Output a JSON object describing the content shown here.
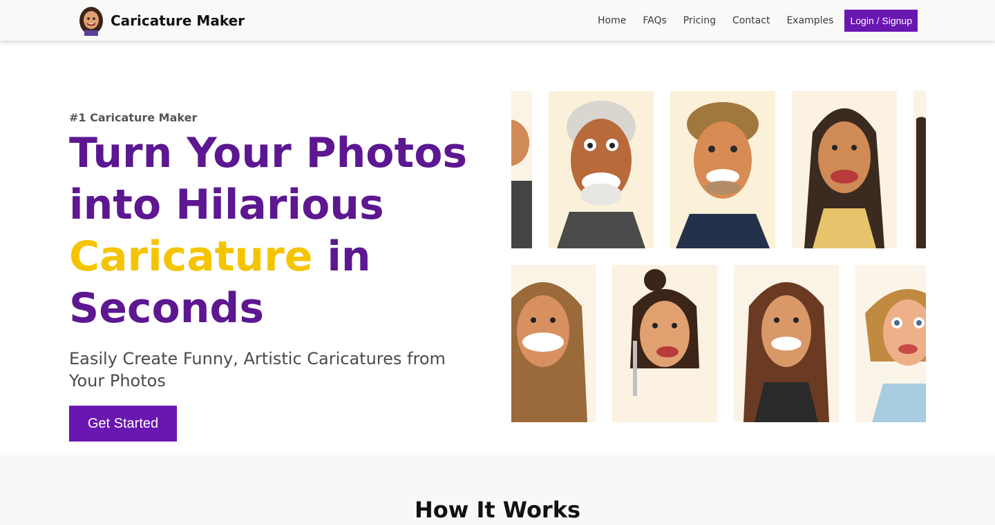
{
  "nav": {
    "brand": "Caricature Maker",
    "links": [
      "Home",
      "FAQs",
      "Pricing",
      "Contact",
      "Examples"
    ],
    "login": "Login / Signup"
  },
  "hero": {
    "kicker": "#1 Caricature Maker",
    "headline_part1": "Turn Your Photos into Hilarious",
    "headline_highlight": "Caricature",
    "headline_part2": "in Seconds",
    "subhead": "Easily Create Funny, Artistic Caricatures from Your Photos",
    "cta": "Get Started"
  },
  "colors": {
    "accent": "#6a16b0",
    "headline": "#5c1791",
    "highlight": "#f5c400"
  },
  "gallery": {
    "row1": [
      "caricature-older-man-gray-beard",
      "caricature-man-blond-hair",
      "caricature-woman-long-dark-hair"
    ],
    "row2": [
      "caricature-woman-wavy-hair",
      "caricature-woman-hair-bun-earrings",
      "caricature-woman-long-brown-hair",
      "caricature-woman-blonde-bob"
    ]
  },
  "how": {
    "title": "How It Works"
  }
}
